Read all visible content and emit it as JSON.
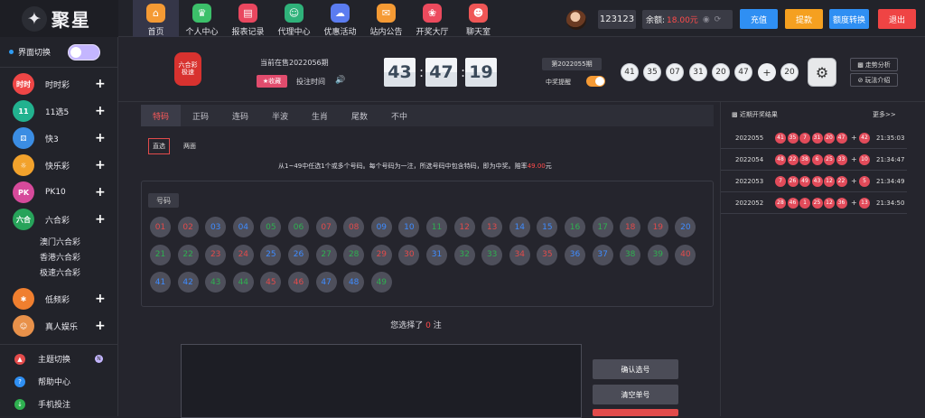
{
  "brand": {
    "name": "聚星",
    "logo_icon": "star-logo"
  },
  "nav": [
    {
      "label": "首页",
      "icon": "home-icon",
      "color": "#f59a34",
      "glyph": "⌂"
    },
    {
      "label": "个人中心",
      "icon": "crown-icon",
      "color": "#3cc06a",
      "glyph": "♛"
    },
    {
      "label": "报表记录",
      "icon": "report-icon",
      "color": "#e9475f",
      "glyph": "▤"
    },
    {
      "label": "代理中心",
      "icon": "agent-icon",
      "color": "#2fb27a",
      "glyph": "☺"
    },
    {
      "label": "优惠活动",
      "icon": "promo-icon",
      "color": "#5b7cf0",
      "glyph": "☁"
    },
    {
      "label": "站内公告",
      "icon": "mail-icon",
      "color": "#f59a34",
      "glyph": "✉"
    },
    {
      "label": "开奖大厅",
      "icon": "lottery-hall-icon",
      "color": "#ec4a5d",
      "glyph": "❀"
    },
    {
      "label": "聊天室",
      "icon": "chat-icon",
      "color": "#ef5656",
      "glyph": "☻"
    }
  ],
  "user": {
    "name": "123123",
    "balance_label": "余额:",
    "balance_value": "18.00元",
    "eye": "◉",
    "refresh": "⟳"
  },
  "top_buttons": [
    {
      "label": "充值",
      "color": "#2f8ff3"
    },
    {
      "label": "提款",
      "color": "#f5a020"
    },
    {
      "label": "额度转换",
      "color": "#2f8ff3"
    },
    {
      "label": "退出",
      "color": "#ef4444"
    }
  ],
  "sidebar": {
    "switch_label": "界面切换",
    "categories": [
      {
        "label": "时时彩",
        "icon": "ssc-icon",
        "color": "#ef4646",
        "glyph": "时时"
      },
      {
        "label": "11选5",
        "icon": "11x5-icon",
        "color": "#22b28f",
        "glyph": "11"
      },
      {
        "label": "快3",
        "icon": "k3-icon",
        "color": "#3b8de3",
        "glyph": "⚄"
      },
      {
        "label": "快乐彩",
        "icon": "klc-icon",
        "color": "#f2a22c",
        "glyph": "☼"
      },
      {
        "label": "PK10",
        "icon": "pk10-icon",
        "color": "#d64a9b",
        "glyph": "PK"
      },
      {
        "label": "六合彩",
        "icon": "lhc-icon",
        "color": "#27a35a",
        "glyph": "六合"
      }
    ],
    "sub_items": [
      "澳门六合彩",
      "香港六合彩",
      "极速六合彩"
    ],
    "categories2": [
      {
        "label": "低频彩",
        "icon": "dpc-icon",
        "color": "#f07f2f",
        "glyph": "✱"
      },
      {
        "label": "真人娱乐",
        "icon": "live-icon",
        "color": "#e8914a",
        "glyph": "☺"
      }
    ],
    "utilities": [
      {
        "label": "主题切换",
        "icon": "theme-icon",
        "color": "#e44b4b",
        "glyph": "▲"
      },
      {
        "label": "帮助中心",
        "icon": "help-icon",
        "color": "#2f8ff3",
        "glyph": "?"
      },
      {
        "label": "手机投注",
        "icon": "mobile-icon",
        "color": "#2fb050",
        "glyph": "↓"
      }
    ]
  },
  "header": {
    "lottery_logo": "六合彩",
    "lottery_logo_sub": "极速",
    "current_issue": "当前在售2022056期",
    "collect": "★收藏",
    "deadline": "投注时间",
    "speaker": "🔊",
    "countdown": [
      "43",
      "47",
      "19"
    ],
    "prev_issue": "第2022055期",
    "alert": "中奖提醒",
    "balls": [
      "41",
      "35",
      "07",
      "31",
      "20",
      "47"
    ],
    "special": "20",
    "plus": "+",
    "reel_icon": "⚙",
    "links": [
      "走势分析",
      "玩法介绍"
    ]
  },
  "tabs": [
    "特码",
    "正码",
    "连码",
    "半波",
    "生肖",
    "尾数",
    "不中"
  ],
  "subtabs": [
    "直选",
    "两面"
  ],
  "rule": {
    "text": "从1~49中任选1个或多个号码。每个号码为一注，所选号码中包含特码，即为中奖。赔率",
    "odds": "49.00",
    "unit": "元"
  },
  "number_label": "号码",
  "numbers": [
    {
      "n": "01",
      "c": "red"
    },
    {
      "n": "02",
      "c": "red"
    },
    {
      "n": "03",
      "c": "blue"
    },
    {
      "n": "04",
      "c": "blue"
    },
    {
      "n": "05",
      "c": "green"
    },
    {
      "n": "06",
      "c": "green"
    },
    {
      "n": "07",
      "c": "red"
    },
    {
      "n": "08",
      "c": "red"
    },
    {
      "n": "09",
      "c": "blue"
    },
    {
      "n": "10",
      "c": "blue"
    },
    {
      "n": "11",
      "c": "green"
    },
    {
      "n": "12",
      "c": "red"
    },
    {
      "n": "13",
      "c": "red"
    },
    {
      "n": "14",
      "c": "blue"
    },
    {
      "n": "15",
      "c": "blue"
    },
    {
      "n": "16",
      "c": "green"
    },
    {
      "n": "17",
      "c": "green"
    },
    {
      "n": "18",
      "c": "red"
    },
    {
      "n": "19",
      "c": "red"
    },
    {
      "n": "20",
      "c": "blue"
    },
    {
      "n": "21",
      "c": "green"
    },
    {
      "n": "22",
      "c": "green"
    },
    {
      "n": "23",
      "c": "red"
    },
    {
      "n": "24",
      "c": "red"
    },
    {
      "n": "25",
      "c": "blue"
    },
    {
      "n": "26",
      "c": "blue"
    },
    {
      "n": "27",
      "c": "green"
    },
    {
      "n": "28",
      "c": "green"
    },
    {
      "n": "29",
      "c": "red"
    },
    {
      "n": "30",
      "c": "red"
    },
    {
      "n": "31",
      "c": "blue"
    },
    {
      "n": "32",
      "c": "green"
    },
    {
      "n": "33",
      "c": "green"
    },
    {
      "n": "34",
      "c": "red"
    },
    {
      "n": "35",
      "c": "red"
    },
    {
      "n": "36",
      "c": "blue"
    },
    {
      "n": "37",
      "c": "blue"
    },
    {
      "n": "38",
      "c": "green"
    },
    {
      "n": "39",
      "c": "green"
    },
    {
      "n": "40",
      "c": "red"
    },
    {
      "n": "41",
      "c": "blue"
    },
    {
      "n": "42",
      "c": "blue"
    },
    {
      "n": "43",
      "c": "green"
    },
    {
      "n": "44",
      "c": "green"
    },
    {
      "n": "45",
      "c": "red"
    },
    {
      "n": "46",
      "c": "red"
    },
    {
      "n": "47",
      "c": "blue"
    },
    {
      "n": "48",
      "c": "blue"
    },
    {
      "n": "49",
      "c": "green"
    }
  ],
  "selected": {
    "prefix": "您选择了",
    "count": "0",
    "suffix": "注"
  },
  "actions": [
    "确认选号",
    "清空单号"
  ],
  "recent": {
    "title": "近期开奖结果",
    "more": "更多>>",
    "rows": [
      {
        "issue": "2022055",
        "balls": [
          "41",
          "35",
          "7",
          "31",
          "20",
          "47"
        ],
        "special": "42",
        "time": "21:35:03"
      },
      {
        "issue": "2022054",
        "balls": [
          "48",
          "22",
          "38",
          "6",
          "25",
          "33"
        ],
        "special": "10",
        "time": "21:34:47"
      },
      {
        "issue": "2022053",
        "balls": [
          "7",
          "26",
          "49",
          "43",
          "12",
          "22"
        ],
        "special": "5",
        "time": "21:34:49"
      },
      {
        "issue": "2022052",
        "balls": [
          "28",
          "46",
          "1",
          "25",
          "12",
          "36"
        ],
        "special": "13",
        "time": "21:34:50"
      }
    ]
  }
}
